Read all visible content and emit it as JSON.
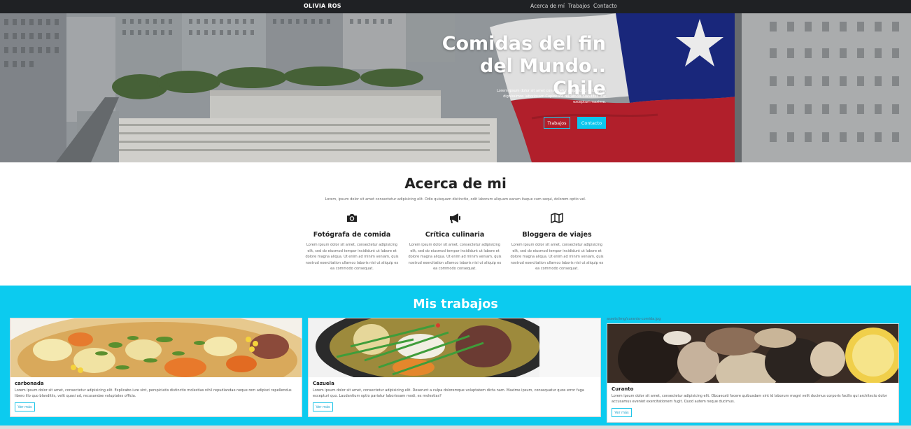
{
  "nav": {
    "brand": "OLIVIA ROS",
    "links": [
      "Acerca de mí",
      "Trabajos",
      "Contacto"
    ]
  },
  "hero": {
    "title_line1": "Comidas del fin",
    "title_line2": "del Mundo.. Chile",
    "text_line1": "Lorem ipsum dolor sit amet consectetur adipisicing elit. Facilis",
    "text_line2": "dignissimos laboriosam Cupiditate reiciendis blanditiis. Est",
    "text_line3": "excepturi maxime.",
    "button_1": "Trabajos",
    "button_2": "Contacto"
  },
  "about": {
    "title": "Acerca de mi",
    "intro": "Lorem, ipsum dolor sit amet consectetur adipisicing elit. Odio quisquam distinctio, odit laborum aliquam earum itaque cum sequi, dolorem optio vel.",
    "features": [
      {
        "icon": "camera-icon",
        "title": "Fotógrafa de comida",
        "text": "Lorem ipsum dolor sit amet, consectetur adipisicing elit, sed do eiusmod tempor incididunt ut labore et dolore magna aliqua. Ut enim ad minim veniam, quis nostrud exercitation ullamco laboris nisi ut aliquip ex ea commodo consequat."
      },
      {
        "icon": "megaphone-icon",
        "title": "Crítica culinaria",
        "text": "Lorem ipsum dolor sit amet, consectetur adipisicing elit, sed do eiusmod tempor incididunt ut labore et dolore magna aliqua. Ut enim ad minim veniam, quis nostrud exercitation ullamco laboris nisi ut aliquip ex ea commodo consequat."
      },
      {
        "icon": "map-icon",
        "title": "Bloggera de viajes",
        "text": "Lorem ipsum dolor sit amet, consectetur adipisicing elit, sed do eiusmod tempor incididunt ut labore et dolore magna aliqua. Ut enim ad minim veniam, quis nostrud exercitation ullamco laboris nisi ut aliquip ex ea commodo consequat."
      }
    ]
  },
  "works": {
    "title": "Mis trabajos",
    "broken_image_path": "assets/img/curanto-comida.jpg",
    "cards": [
      {
        "title": "carbonada",
        "text": "Lorem ipsum dolor sit amet, consectetur adipisicing elit. Explicabo iure sint, perspiciatis distinctio molestias nihil repudiandae neque rem adipisci repellendus libero illo quo blanditiis, velit quasi ad, recusandae voluptates officia.",
        "button": "Ver más"
      },
      {
        "title": "Cazuela",
        "text": "Lorem ipsum dolor sit amet, consectetur adipisicing elit. Deserunt a culpa doloremque voluptatem dicta nam. Maxime ipsum, consequatur quos error fuga excepturi quo. Laudantium optio pariatur laboriosam modi, ex molestias?",
        "button": "Ver más"
      },
      {
        "title": "Curanto",
        "text": "Lorem ipsum dolor sit amet, consectetur adipisicing elit. Obcaecati facere quibusdam sint id laborum magni velit ducimus corporis facilis qui architecto dolor accusamus eveniet exercitationem fugit. Quod autem neque ducimus.",
        "button": "Ver más"
      }
    ]
  },
  "colors": {
    "accent": "#0ccbef",
    "navbar": "#1f2124",
    "flag_blue": "#1c2b86",
    "flag_red": "#c1222f"
  }
}
